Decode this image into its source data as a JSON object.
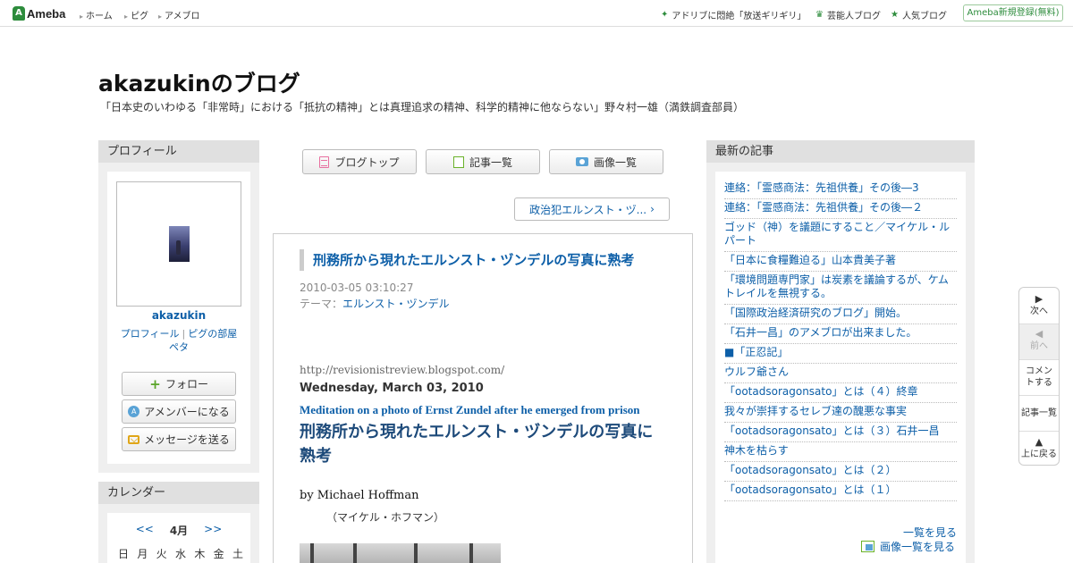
{
  "topbar": {
    "logo": "Ameba",
    "links": [
      "ホーム",
      "ピグ",
      "アメブロ"
    ],
    "promo": "アドリブに悶絶「放送ギリギリ」",
    "celeb": "芸能人ブログ",
    "popular": "人気ブログ",
    "register": "Ameba新規登録(無料)"
  },
  "blog": {
    "title": "akazukinのブログ",
    "description": "「日本史のいわゆる「非常時」における「抵抗の精神」とは真理追求の精神、科学的精神に他ならない」野々村一雄（満鉄調査部員）"
  },
  "profile": {
    "heading": "プロフィール",
    "name": "akazukin",
    "link_profile": "プロフィール",
    "link_room": "ピグの部屋",
    "link_peta": "ペタ",
    "follow": "フォロー",
    "amember": "アメンバーになる",
    "message": "メッセージを送る"
  },
  "calendar": {
    "heading": "カレンダー",
    "prev": "<<",
    "month": "4月",
    "next": ">>",
    "days": [
      "日",
      "月",
      "火",
      "水",
      "木",
      "金",
      "土"
    ]
  },
  "nav": {
    "blog_top": "ブログトップ",
    "entries": "記事一覧",
    "images": "画像一覧",
    "prev_entry": "政治犯エルンスト・ヅ..."
  },
  "article": {
    "title": "刑務所から現れたエルンスト・ヅンデルの写真に熟考",
    "date": "2010-03-05 03:10:27",
    "theme_label": "テーマ：",
    "theme": "エルンスト・ヅンデル",
    "source_url": "http://revisionistreview.blogspot.com/",
    "source_date": "Wednesday, March 03, 2010",
    "en_title": "Meditation on a photo of Ernst Zundel after he emerged from prison",
    "ja_title": "刑務所から現れたエルンスト・ヅンデルの写真に熟考",
    "byline": "by  Michael  Hoffman",
    "byline_ja": "（マイケル・ホフマン）"
  },
  "recent": {
    "heading": "最新の記事",
    "items": [
      "連絡：「霊感商法：先祖供養」その後―3",
      "連絡：「霊感商法：先祖供養」その後―２",
      "ゴッド（神）を議題にすること／マイケル・ルパート",
      "「日本に食糧難迫る」山本貴美子著",
      "「環境問題専門家」は炭素を議論するが、ケムトレイルを無視する。",
      "「国際政治経済研究のブログ」開始。",
      "「石井一昌」のアメブロが出来ました。",
      "■「正忍記」",
      "ウルフ爺さん",
      "「ootadsoragonsato」とは（４）終章",
      "我々が崇拝するセレブ達の醜悪な事実",
      "「ootadsoragonsato」とは（３）石井一昌",
      "神木を枯らす",
      "「ootadsoragonsato」とは（２）",
      "「ootadsoragonsato」とは（１）"
    ],
    "more_list": "一覧を見る",
    "more_images": "画像一覧を見る"
  },
  "floatnav": {
    "next": "次へ",
    "prev": "前へ",
    "comment": "コメントする",
    "entries": "記事一覧",
    "top": "上に戻る"
  }
}
